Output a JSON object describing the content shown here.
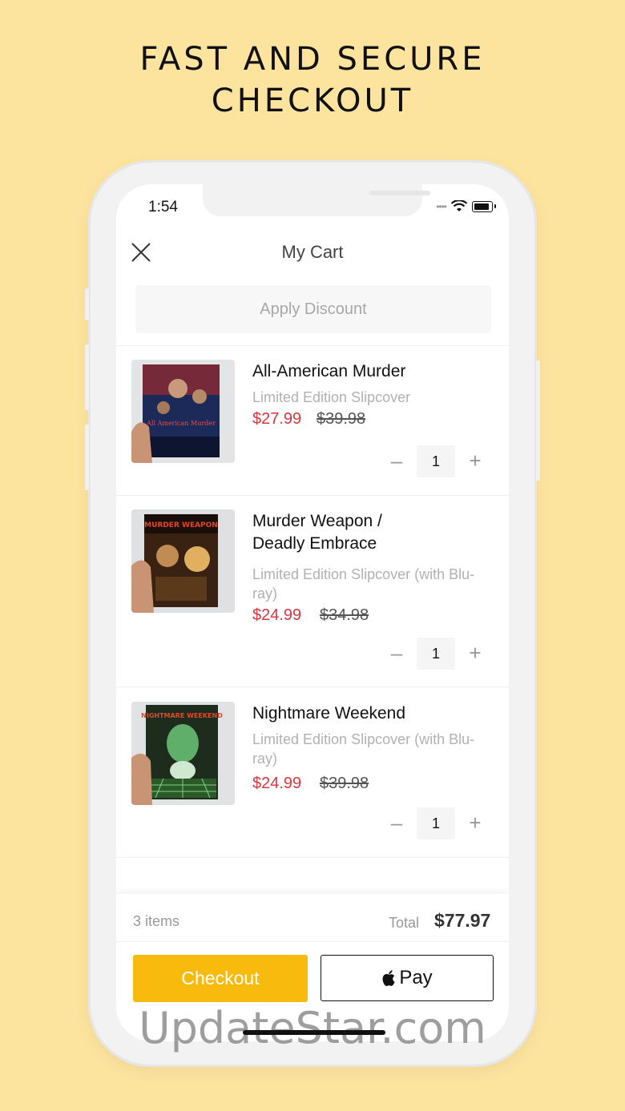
{
  "headline": [
    "FAST AND SECURE",
    "CHECKOUT"
  ],
  "status_bar": {
    "time": "1:54"
  },
  "nav": {
    "title": "My Cart"
  },
  "discount": {
    "label": "Apply Discount"
  },
  "items": [
    {
      "title": "All-American Murder",
      "variant": "Limited Edition Slipcover",
      "price": "$27.99",
      "original_price": "$39.98",
      "quantity": "1",
      "cover_text": "All American Murder"
    },
    {
      "title": "Murder Weapon / Deadly Embrace",
      "variant": "Limited Edition Slipcover (with Blu-ray)",
      "price": "$24.99",
      "original_price": "$34.98",
      "quantity": "1",
      "cover_text": "MURDER WEAPON"
    },
    {
      "title": "Nightmare Weekend",
      "variant": "Limited Edition Slipcover (with Blu-ray)",
      "price": "$24.99",
      "original_price": "$39.98",
      "quantity": "1",
      "cover_text": "NIGHTMARE WEEKEND"
    }
  ],
  "summary": {
    "count": "3 items",
    "total_label": "Total",
    "total_value": "$77.97"
  },
  "actions": {
    "checkout": "Checkout",
    "apple_pay": "Pay"
  },
  "watermark": "UpdateStar.com",
  "colors": {
    "background": "#fde49e",
    "accent": "#f8bb0d",
    "sale_price": "#d9363e"
  },
  "icons": {
    "close": "close-icon",
    "minus": "minus-icon",
    "plus": "plus-icon",
    "apple": "apple-logo-icon",
    "wifi": "wifi-icon",
    "battery": "battery-icon"
  }
}
